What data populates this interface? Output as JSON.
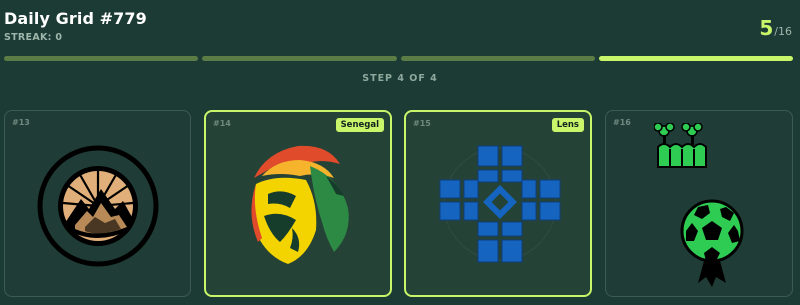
{
  "game": {
    "title": "Daily Grid #779",
    "streak": "STREAK: 0",
    "score": "5",
    "score_total": "/16",
    "step_label": "STEP 4 OF 4"
  },
  "progress": {
    "steps": 4,
    "current": 4
  },
  "cards": [
    {
      "number": "#13",
      "badge": null,
      "crest": "mountain-sunrise-ring-icon"
    },
    {
      "number": "#14",
      "badge": "Senegal",
      "crest": "senegal-lion-icon"
    },
    {
      "number": "#15",
      "badge": "Lens",
      "crest": "blue-cross-tiles-icon"
    },
    {
      "number": "#16",
      "badge": null,
      "crest": "soccer-ball-trees-icon"
    }
  ],
  "colors": {
    "background": "#1c3b34",
    "accent": "#c9f56a",
    "progress_inactive": "#5b7c45",
    "card_border": "#3c5c53"
  }
}
